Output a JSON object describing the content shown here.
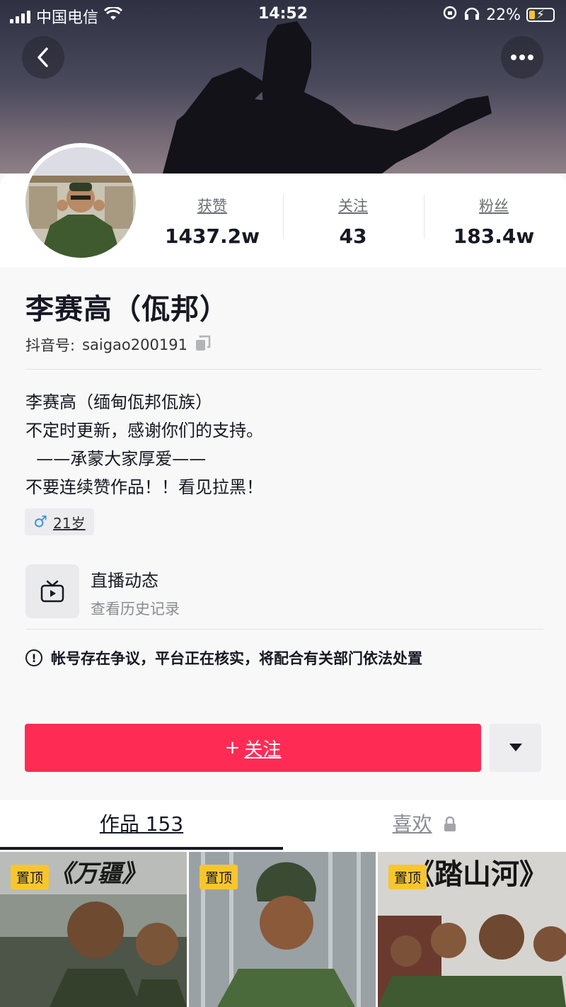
{
  "status_bar": {
    "carrier": "中国电信",
    "time": "14:52",
    "battery": "22%"
  },
  "profile": {
    "name": "李赛高（佤邦）",
    "douyin_id_label": "抖音号:",
    "douyin_id": "saigao200191",
    "stats": [
      {
        "label": "获赞",
        "value": "1437.2w"
      },
      {
        "label": "关注",
        "value": "43"
      },
      {
        "label": "粉丝",
        "value": "183.4w"
      }
    ],
    "bio": [
      "李赛高（缅甸佤邦佤族）",
      "不定时更新，感谢你们的支持。",
      "  ——承蒙大家厚爱——",
      "不要连续赞作品！！看见拉黑！"
    ],
    "gender_symbol": "♂",
    "age": "21岁"
  },
  "live": {
    "title": "直播动态",
    "subtitle": "查看历史记录"
  },
  "warning": "帐号存在争议，平台正在核实，将配合有关部门依法处置",
  "actions": {
    "follow_plus": "+",
    "follow_label": "关注"
  },
  "tabs": {
    "works": "作品 153",
    "likes": "喜欢"
  },
  "videos": [
    {
      "pin": "置顶",
      "overlay": "《万疆》"
    },
    {
      "pin": "置顶",
      "overlay": ""
    },
    {
      "pin": "置顶",
      "overlay": "《踏山河》"
    }
  ],
  "colors": {
    "accent": "#fe2c55",
    "pin": "#f7c62f",
    "male": "#3a8ee6"
  }
}
